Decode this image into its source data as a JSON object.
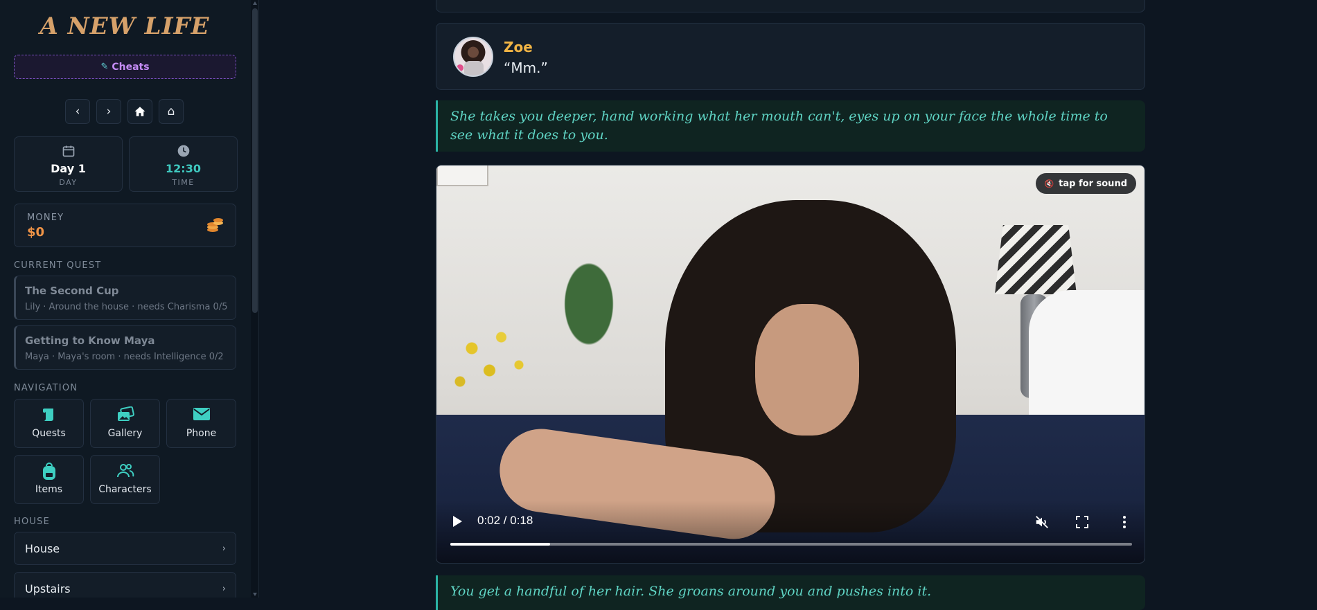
{
  "app": {
    "title": "A NEW LIFE"
  },
  "sidebar": {
    "cheats_label": "Cheats",
    "nav_buttons": {
      "back": "‹",
      "forward": "›",
      "home": "⌂"
    },
    "day": {
      "value": "Day 1",
      "label": "DAY"
    },
    "time": {
      "value": "12:30",
      "label": "TIME"
    },
    "money": {
      "label": "MONEY",
      "value": "$0"
    },
    "current_quest_label": "CURRENT QUEST",
    "quests": [
      {
        "title": "The Second Cup",
        "subtitle": "Lily · Around the house · needs Charisma 0/5"
      },
      {
        "title": "Getting to Know Maya",
        "subtitle": "Maya · Maya's room · needs Intelligence 0/2"
      }
    ],
    "navigation_label": "NAVIGATION",
    "nav_tiles": [
      {
        "label": "Quests",
        "icon": "scroll-icon"
      },
      {
        "label": "Gallery",
        "icon": "images-icon"
      },
      {
        "label": "Phone",
        "icon": "envelope-icon"
      },
      {
        "label": "Items",
        "icon": "backpack-icon"
      },
      {
        "label": "Characters",
        "icon": "users-icon"
      }
    ],
    "house_label": "HOUSE",
    "locations": [
      {
        "label": "House"
      },
      {
        "label": "Upstairs"
      }
    ]
  },
  "main": {
    "dialogue": {
      "speaker": "Zoe",
      "line": "“Mm.”"
    },
    "narration_1": "She takes you deeper, hand working what her mouth can't, eyes up on your face the whole time to see what it does to you.",
    "video": {
      "tap_for_sound": "tap for sound",
      "time": "0:02 / 0:18",
      "progress": 0.146
    },
    "narration_2": "You get a handful of her hair. She groans around you and pushes into it."
  },
  "colors": {
    "accent_teal": "#5fd4c4",
    "speaker_gold": "#f2b545",
    "money_orange": "#f09447",
    "cheats_purple": "#c58cf5"
  }
}
